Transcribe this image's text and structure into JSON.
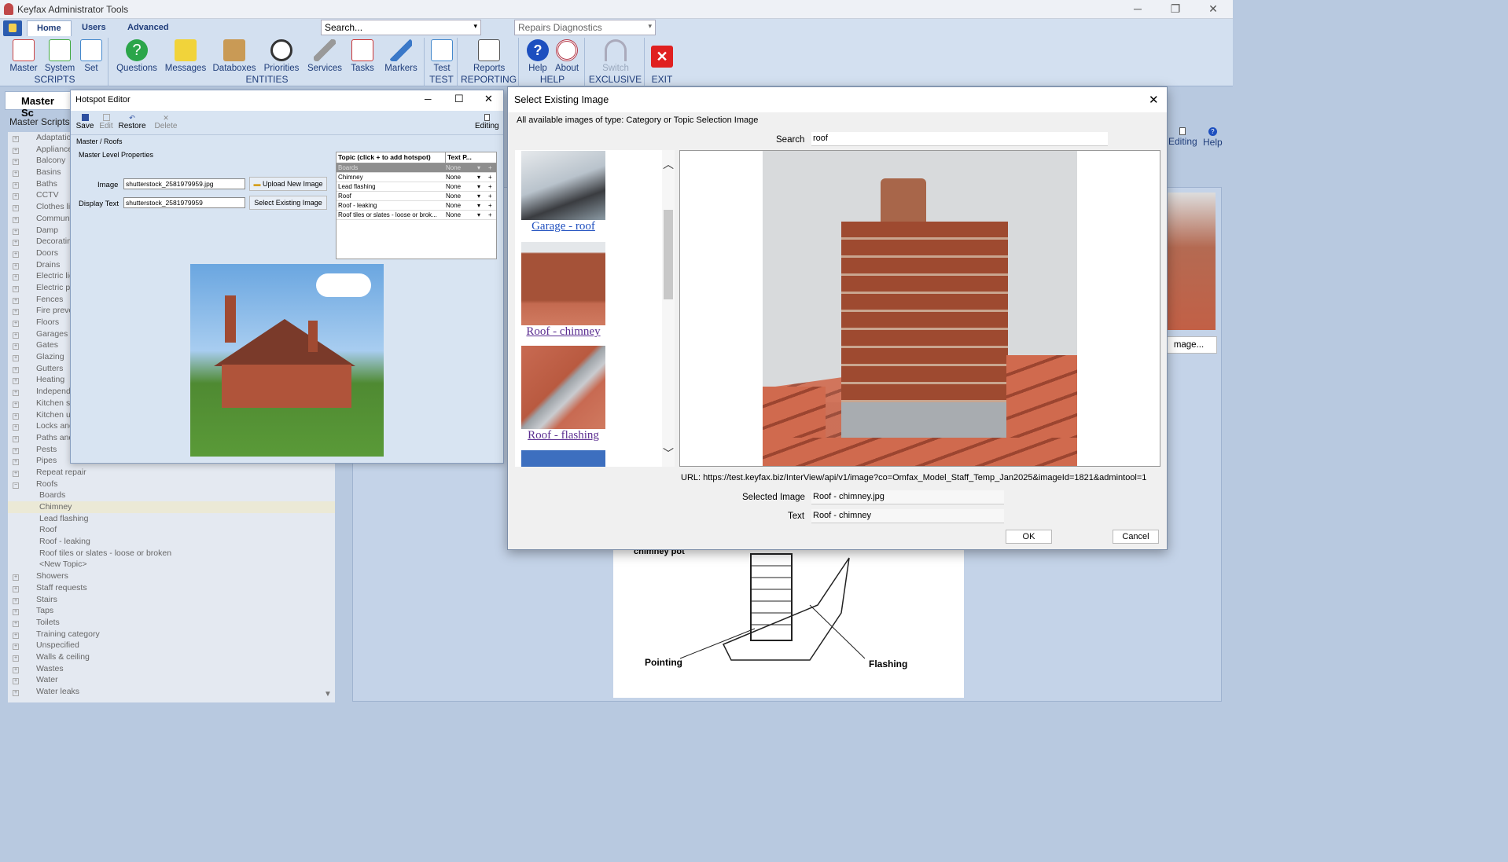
{
  "app": {
    "title": "Keyfax Administrator Tools"
  },
  "ribbon": {
    "tabs": [
      "Home",
      "Users",
      "Advanced"
    ],
    "search_placeholder": "Search...",
    "dropdown_value": "Repairs Diagnostics",
    "groups": [
      {
        "label": "SCRIPTS",
        "buttons": [
          "Master",
          "System",
          "Set"
        ]
      },
      {
        "label": "ENTITIES",
        "buttons": [
          "Questions",
          "Messages",
          "Databoxes",
          "Priorities",
          "Services",
          "Tasks",
          "Markers"
        ]
      },
      {
        "label": "TEST",
        "buttons": [
          "Test"
        ]
      },
      {
        "label": "REPORTING",
        "buttons": [
          "Reports"
        ]
      },
      {
        "label": "HELP",
        "buttons": [
          "Help",
          "About"
        ]
      },
      {
        "label": "EXCLUSIVE",
        "buttons": [
          "Switch"
        ]
      },
      {
        "label": "EXIT",
        "buttons": [
          ""
        ]
      }
    ]
  },
  "master_tab": {
    "title": "Master Sc",
    "section": "Master Scripts"
  },
  "tree": {
    "items": [
      "Adaptation",
      "Appliances",
      "Balcony",
      "Basins",
      "Baths",
      "CCTV",
      "Clothes lin",
      "Communal",
      "Damp",
      "Decorating",
      "Doors",
      "Drains",
      "Electric lig",
      "Electric po",
      "Fences",
      "Fire preve",
      "Floors",
      "Garages",
      "Gates",
      "Glazing",
      "Gutters",
      "Heating",
      "Independe",
      "Kitchen si",
      "Kitchen un",
      "Locks and",
      "Paths and",
      "Pests",
      "Pipes",
      "Repeat repair",
      "Roofs"
    ],
    "roof_children": [
      "Boards",
      "Chimney",
      "Lead flashing",
      "Roof",
      "Roof - leaking",
      "Roof tiles or slates - loose or broken",
      "<New Topic>"
    ],
    "after": [
      "Showers",
      "Staff requests",
      "Stairs",
      "Taps",
      "Toilets",
      "Training category",
      "Unspecified",
      "Walls & ceiling",
      "Wastes",
      "Water",
      "Water leaks"
    ]
  },
  "hotspot": {
    "title": "Hotspot Editor",
    "toolbar": {
      "save": "Save",
      "edit": "Edit",
      "restore": "Restore",
      "delete": "Delete",
      "editing": "Editing"
    },
    "breadcrumb": "Master / Roofs",
    "section": "Master Level Properties",
    "image_label": "Image",
    "image_value": "shutterstock_2581979959.jpg",
    "display_label": "Display Text",
    "display_value": "shutterstock_2581979959",
    "upload_btn": "Upload New Image",
    "select_btn": "Select Existing Image",
    "table_headers": [
      "Topic (click + to add hotspot)",
      "Text P..."
    ],
    "rows": [
      {
        "topic": "Boards",
        "text": "None"
      },
      {
        "topic": "Chimney",
        "text": "None"
      },
      {
        "topic": "Lead flashing",
        "text": "None"
      },
      {
        "topic": "Roof",
        "text": "None"
      },
      {
        "topic": "Roof - leaking",
        "text": "None"
      },
      {
        "topic": "Roof tiles or slates - loose or brok...",
        "text": "None"
      }
    ]
  },
  "behind": {
    "editing": "Editing",
    "help": "Help",
    "image_btn": "mage...",
    "label1": "Pointing",
    "label2": "Flashing",
    "label3": "chimney pot"
  },
  "dialog": {
    "title": "Select Existing Image",
    "subtitle": "All available images of type: Category or Topic Selection Image",
    "search_label": "Search",
    "search_value": "roof",
    "thumbs": [
      "Garage - roof",
      "Roof - chimney",
      "Roof - flashing"
    ],
    "url": "URL: https://test.keyfax.biz/InterView/api/v1/image?co=Omfax_Model_Staff_Temp_Jan2025&imageId=1821&admintool=1",
    "selected_label": "Selected Image",
    "selected_value": "Roof - chimney.jpg",
    "text_label": "Text",
    "text_value": "Roof - chimney",
    "ok": "OK",
    "cancel": "Cancel"
  }
}
